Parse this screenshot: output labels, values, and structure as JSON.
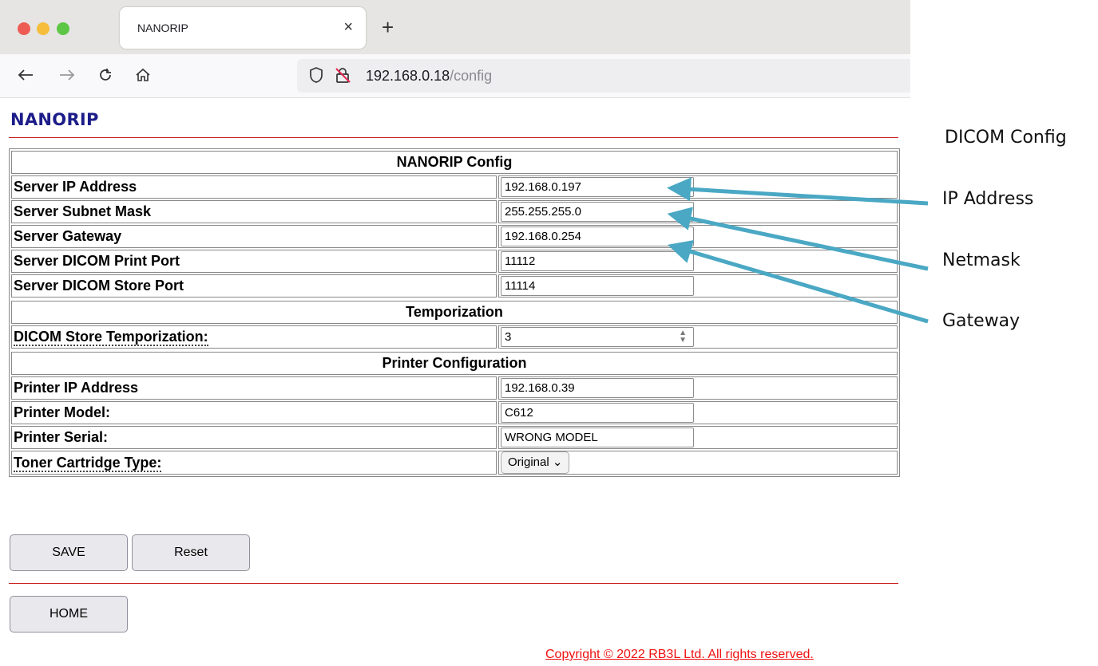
{
  "browser": {
    "tab_title": "NANORIP",
    "tab_close": "×",
    "new_tab": "+",
    "url_host": "192.168.0.18",
    "url_path": "/config"
  },
  "page": {
    "title": "NANORIP",
    "sections": {
      "nanorip_config": {
        "header": "NANORIP Config",
        "rows": [
          {
            "label": "Server IP Address",
            "value": "192.168.0.197"
          },
          {
            "label": "Server Subnet Mask",
            "value": "255.255.255.0"
          },
          {
            "label": "Server Gateway",
            "value": "192.168.0.254"
          },
          {
            "label": "Server DICOM Print Port",
            "value": "11112"
          },
          {
            "label": "Server DICOM Store Port",
            "value": "11114"
          }
        ]
      },
      "temporization": {
        "header": "Temporization",
        "label": "DICOM Store Temporization:",
        "value": "3"
      },
      "printer": {
        "header": "Printer Configuration",
        "rows": [
          {
            "label": "Printer IP Address",
            "value": "192.168.0.39"
          },
          {
            "label": "Printer Model:",
            "value": "C612"
          },
          {
            "label": "Printer Serial:",
            "value": "WRONG MODEL"
          }
        ],
        "toner_label": "Toner Cartridge Type:",
        "toner_value": "Original"
      }
    },
    "buttons": {
      "save": "SAVE",
      "reset": "Reset",
      "home": "HOME"
    },
    "copyright": "Copyright © 2022 RB3L Ltd. All rights reserved."
  },
  "annotations": {
    "dicom_config": "DICOM Config",
    "ip_address": "IP Address",
    "netmask": "Netmask",
    "gateway": "Gateway",
    "arrow_color": "#4aa8c4"
  }
}
